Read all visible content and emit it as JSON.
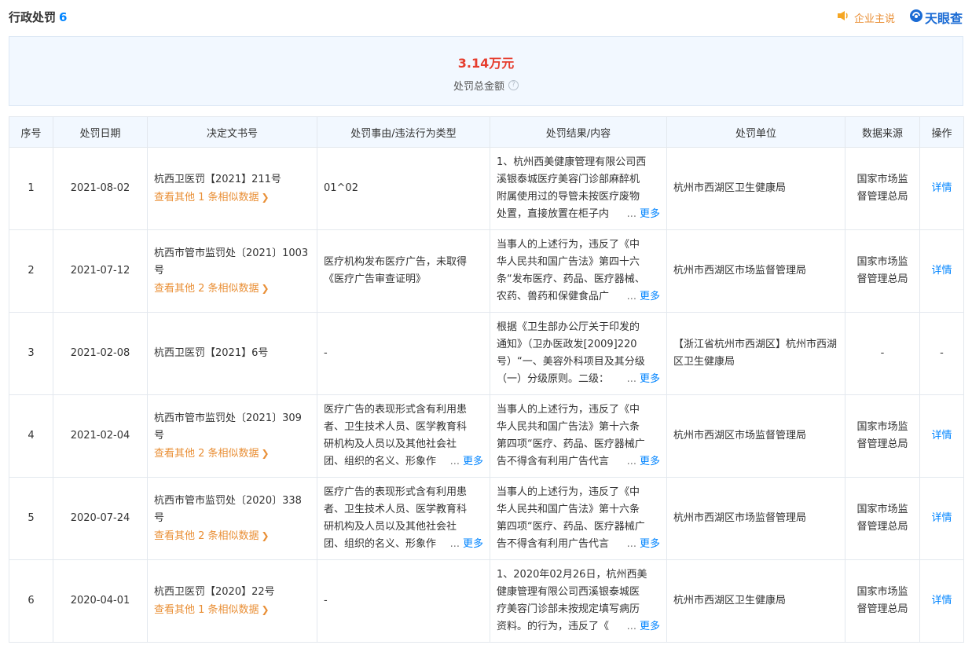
{
  "header": {
    "title": "行政处罚",
    "count": "6",
    "company_says": "企业主说",
    "logo_text": "天眼查"
  },
  "summary": {
    "amount": "3.14万元",
    "label": "处罚总金额",
    "help": "?"
  },
  "table": {
    "columns": [
      "序号",
      "处罚日期",
      "决定文书号",
      "处罚事由/违法行为类型",
      "处罚结果/内容",
      "处罚单位",
      "数据来源",
      "操作"
    ],
    "more_label": "更多",
    "ellipsis": "...",
    "rows": [
      {
        "index": "1",
        "date": "2021-08-02",
        "doc_no": "杭西卫医罚【2021】211号",
        "similar": "查看其他 1 条相似数据",
        "reason_lines": [
          "01^02"
        ],
        "reason_last": "",
        "result_lines": [
          "1、杭州西美健康管理有限公司西",
          "溪银泰城医疗美容门诊部麻醉机",
          "附属使用过的导管未按医疗废物"
        ],
        "result_last": "处置，直接放置在柜子内",
        "unit": "杭州市西湖区卫生健康局",
        "source": "国家市场监督管理总局",
        "action": "详情"
      },
      {
        "index": "2",
        "date": "2021-07-12",
        "doc_no": "杭西市管市监罚处〔2021〕1003号",
        "similar": "查看其他 2 条相似数据",
        "reason_lines": [
          "医疗机构发布医疗广告，未取得《医疗广告审查证明》"
        ],
        "reason_last": "",
        "result_lines": [
          "当事人的上述行为，违反了《中",
          "华人民共和国广告法》第四十六",
          "条“发布医疗、药品、医疗器械、"
        ],
        "result_last": "农药、兽药和保健食品广",
        "unit": "杭州市西湖区市场监督管理局",
        "source": "国家市场监督管理总局",
        "action": "详情"
      },
      {
        "index": "3",
        "date": "2021-02-08",
        "doc_no": "杭西卫医罚【2021】6号",
        "similar": "",
        "reason_lines": [
          "-"
        ],
        "reason_last": "",
        "result_lines": [
          "根据《卫生部办公厅关于印发的",
          "通知》（卫办医政发[2009]220",
          "号）“一、美容外科项目及其分级"
        ],
        "result_last": "（一）分级原则。二级：",
        "unit": "【浙江省杭州市西湖区】杭州市西湖区卫生健康局",
        "source": "-",
        "action": "-"
      },
      {
        "index": "4",
        "date": "2021-02-04",
        "doc_no": "杭西市管市监罚处〔2021〕309号",
        "similar": "查看其他 2 条相似数据",
        "reason_lines": [
          "医疗广告的表现形式含有利用患",
          "者、卫生技术人员、医学教育科",
          "研机构及人员以及其他社会社"
        ],
        "reason_last": "团、组织的名义、形象作",
        "result_lines": [
          "当事人的上述行为，违反了《中",
          "华人民共和国广告法》第十六条",
          "第四项“医疗、药品、医疗器械广"
        ],
        "result_last": "告不得含有利用广告代言",
        "unit": "杭州市西湖区市场监督管理局",
        "source": "国家市场监督管理总局",
        "action": "详情"
      },
      {
        "index": "5",
        "date": "2020-07-24",
        "doc_no": "杭西市管市监罚处〔2020〕338号",
        "similar": "查看其他 2 条相似数据",
        "reason_lines": [
          "医疗广告的表现形式含有利用患",
          "者、卫生技术人员、医学教育科",
          "研机构及人员以及其他社会社"
        ],
        "reason_last": "团、组织的名义、形象作",
        "result_lines": [
          "当事人的上述行为，违反了《中",
          "华人民共和国广告法》第十六条",
          "第四项“医疗、药品、医疗器械广"
        ],
        "result_last": "告不得含有利用广告代言",
        "unit": "杭州市西湖区市场监督管理局",
        "source": "国家市场监督管理总局",
        "action": "详情"
      },
      {
        "index": "6",
        "date": "2020-04-01",
        "doc_no": "杭西卫医罚【2020】22号",
        "similar": "查看其他 1 条相似数据",
        "reason_lines": [
          "-"
        ],
        "reason_last": "",
        "result_lines": [
          "1、2020年02月26日，杭州西美",
          "健康管理有限公司西溪银泰城医",
          "疗美容门诊部未按规定填写病历"
        ],
        "result_last": "资料。的行为，违反了《",
        "unit": "杭州市西湖区卫生健康局",
        "source": "国家市场监督管理总局",
        "action": "详情"
      }
    ]
  },
  "colors": {
    "accent_blue": "#0084ff",
    "orange": "#e98f36",
    "amount_red": "#e63d2e",
    "header_bg": "#f2f8ff"
  }
}
